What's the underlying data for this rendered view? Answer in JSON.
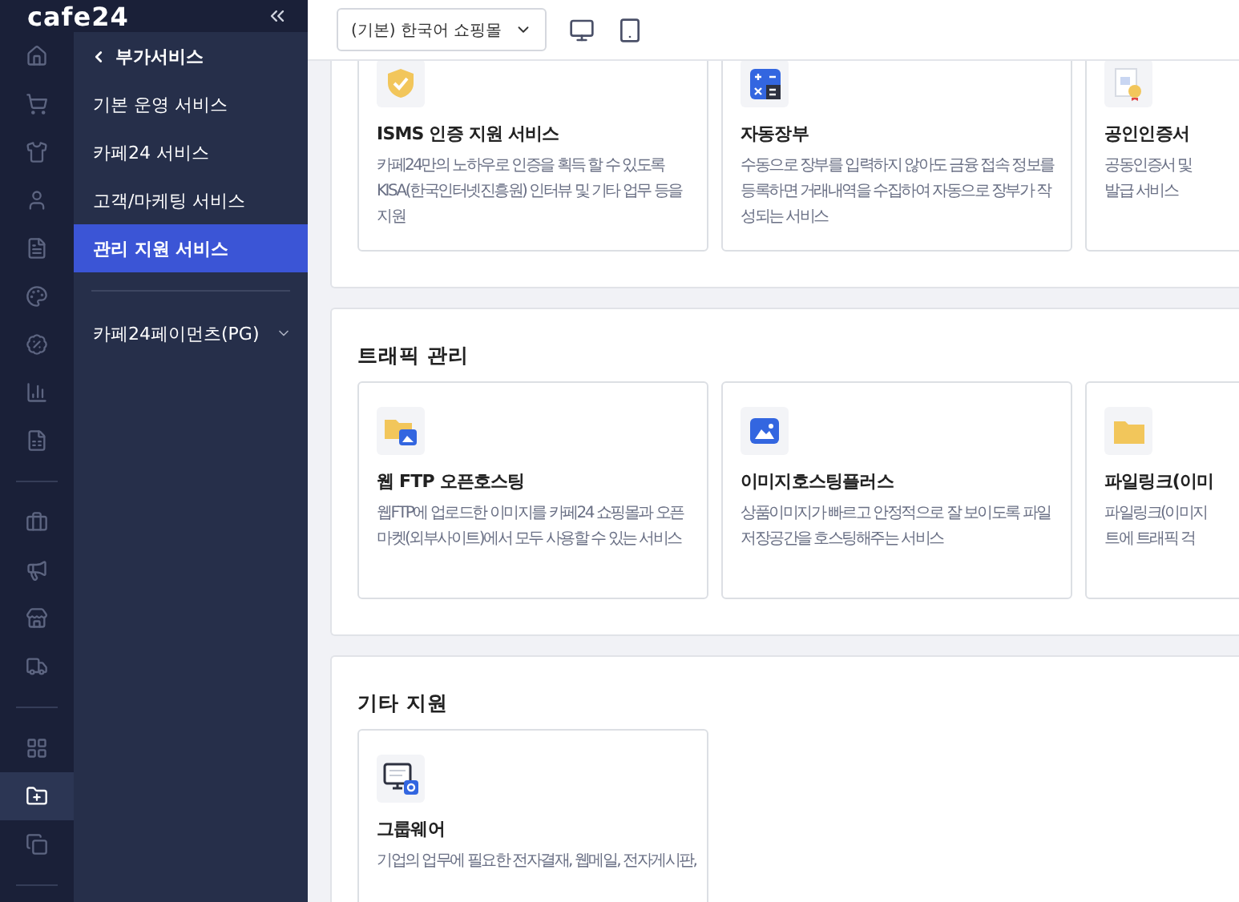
{
  "brand": {
    "logo": "cafe24"
  },
  "rail": [
    {
      "items": [
        {
          "kind": "home",
          "selected": false
        },
        {
          "kind": "cart",
          "selected": false
        },
        {
          "kind": "shirt",
          "selected": false
        },
        {
          "kind": "user",
          "selected": false
        },
        {
          "kind": "document",
          "selected": false
        },
        {
          "kind": "palette",
          "selected": false
        },
        {
          "kind": "discount",
          "selected": false
        },
        {
          "kind": "chart",
          "selected": false
        },
        {
          "kind": "sheet",
          "selected": false
        }
      ]
    },
    {
      "items": [
        {
          "kind": "briefcase",
          "selected": false
        },
        {
          "kind": "megaphone",
          "selected": false
        },
        {
          "kind": "store",
          "selected": false
        },
        {
          "kind": "truck",
          "selected": false
        }
      ]
    },
    {
      "items": [
        {
          "kind": "apps",
          "selected": false
        },
        {
          "kind": "folder",
          "selected": true
        },
        {
          "kind": "copy",
          "selected": false
        }
      ]
    }
  ],
  "submenu": {
    "back": "부가서비스",
    "items": [
      {
        "label": "기본 운영 서비스",
        "selected": false
      },
      {
        "label": "카페24 서비스",
        "selected": false
      },
      {
        "label": "고객/마케팅 서비스",
        "selected": false
      },
      {
        "label": "관리 지원 서비스",
        "selected": true
      }
    ],
    "extra": [
      {
        "label": "카페24페이먼츠(PG)",
        "expanded": false
      }
    ]
  },
  "topbar": {
    "mall_select": "(기본) 한국어 쇼핑몰"
  },
  "sections": [
    {
      "cards": [
        {
          "kind": "shield",
          "title": "ISMS 인증 지원 서비스",
          "desc": [
            "카페24만의 노하우로 인증을 획득 할 수 있도록",
            "KISA(한국인터넷진흥원) 인터뷰 및 기타 업무 등을",
            "지원"
          ]
        },
        {
          "kind": "calculator",
          "title": "자동장부",
          "desc": [
            "수동으로 장부를 입력하지 않아도 금융 접속 정보를",
            "등록하면 거래내역을 수집하여 자동으로 장부가 작",
            "성되는 서비스"
          ]
        },
        {
          "kind": "certificate",
          "title": "공인인증서",
          "desc": [
            "공동인증서 및",
            "발급 서비스"
          ]
        }
      ]
    },
    {
      "title": "트래픽 관리",
      "cards": [
        {
          "kind": "folder-image",
          "title": "웹 FTP 오픈호스팅",
          "desc": [
            "웹FTP에 업로드한 이미지를 카페24 쇼핑몰과 오픈",
            "마켓(외부사이트)에서 모두 사용할 수 있는 서비스"
          ]
        },
        {
          "kind": "image",
          "title": "이미지호스팅플러스",
          "desc": [
            "상품이미지가 빠르고 안정적으로 잘 보이도록 파일",
            "저장공간을 호스팅해주는 서비스"
          ]
        },
        {
          "kind": "folder",
          "title": "파일링크(이미",
          "desc": [
            "파일링크(이미지",
            "트에 트래픽 걱"
          ]
        }
      ]
    },
    {
      "title": "기타 지원",
      "cards": [
        {
          "kind": "monitor",
          "title": "그룹웨어",
          "desc": [
            "기업의 업무에 필요한 전자결재, 웹메일, 전자게시판,"
          ]
        }
      ]
    }
  ]
}
